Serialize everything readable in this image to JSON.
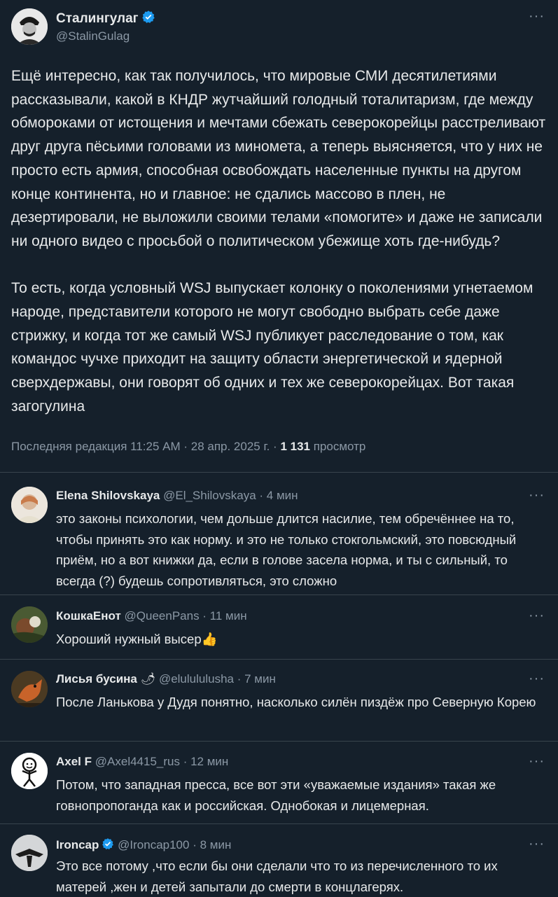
{
  "tweet": {
    "author_name": "Сталингулаг",
    "author_handle": "@StalinGulag",
    "paragraphs": [
      "Ещё интересно, как так получилось, что мировые СМИ десятилетиями рассказывали, какой в КНДР жутчайший голодный тоталитаризм, где между обмороками от истощения и мечтами сбежать северокорейцы расстреливают друг друга пёсьими головами из миномета, а теперь выясняется, что у них не просто есть армия, способная освобождать населенные пункты на другом конце континента, но и главное: не сдались массово в плен, не дезертировали, не выложили своими телами «помогите» и даже не записали ни одного видео с просьбой о политическом убежище хоть где-нибудь?",
      "То есть, когда условный WSJ выпускает колонку о поколениями угнетаемом народе, представители которого не могут свободно выбрать себе даже стрижку, и когда тот же самый WSJ публикует расследование о том, как командос чучхе приходит на защиту области энергетической и ядерной сверхдержавы, они говорят об одних и тех же северокорейцах. Вот такая загогулина"
    ],
    "meta_prefix": "Последняя редакция 11:25 AM · 28 апр. 2025 г. · ",
    "views_count": "1 131",
    "views_label": " просмотр"
  },
  "replies": [
    {
      "name": "Elena Shilovskaya",
      "handle": "@El_Shilovskaya",
      "time": " · 4 мин",
      "text": "это законы психологии, чем дольше длится насилие, тем обречённее на то, чтобы принять это как норму. и это не только стокгольмский, это повсюдный приём, но а вот книжки да, если в голове засела норма, и ты с сильный, то всегда (?) будешь сопротивляться, это сложно"
    },
    {
      "name": "КошкаЕнот",
      "handle": "@QueenPans",
      "time": " · 11 мин",
      "text": "Хороший нужный высер👍"
    },
    {
      "name": "Лисья бусина",
      "name_emoji": "🌶",
      "handle": "@elulululusha",
      "time": " · 7 мин",
      "text": "После Ланькова у Дудя понятно, насколько силён пиздёж про Северную Корею"
    },
    {
      "name": "Axel F",
      "handle": "@Axel4415_rus",
      "time": " · 12 мин",
      "text": "Потом, что западная пресса, все вот эти «уважаемые издания» такая же говнопропоганда как и российская. Однобокая и лицемерная."
    },
    {
      "name": "Ironcap",
      "handle": "@Ironcap100",
      "time": " · 8 мин",
      "text": "Это все потому ,что если бы они сделали что то из перечисленного то их матерей ,жен и детей запытали до смерти в концлагерях."
    }
  ],
  "icons": {
    "more": "more-dots-icon",
    "verified": "verified-badge-icon"
  },
  "colors": {
    "background": "#15202b",
    "text": "#e7e9ea",
    "muted": "#8b98a5",
    "verified": "#1d9bf0",
    "divider": "#38444d"
  }
}
